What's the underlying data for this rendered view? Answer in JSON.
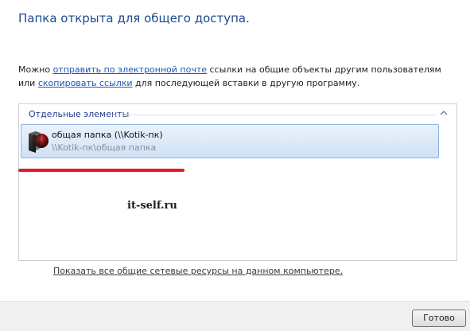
{
  "dialog": {
    "title": "Папка открыта для общего доступа."
  },
  "description": {
    "part1": "Можно ",
    "link_email": "отправить по электронной почте",
    "part2": " ссылки на общие объекты другим пользователям или ",
    "link_copy": "скопировать ссылки",
    "part3": " для последующей вставки в другую программу."
  },
  "items_panel": {
    "group_label": "Отдельные элементы",
    "items": [
      {
        "name": "общая папка (\\\\Kotik-пк)",
        "path": "\\\\Kotik-пк\\общая папка"
      }
    ]
  },
  "watermark": "it-self.ru",
  "show_all_link": "Показать все общие сетевые ресурсы на данном компьютере.",
  "footer": {
    "done_button": "Готово"
  },
  "colors": {
    "title": "#1e4a8c",
    "link": "#1f55b5",
    "selection_border": "#8fb3df",
    "annotation_red": "#e01a2b"
  },
  "icons": {
    "collapse": "chevron-up-icon",
    "folder": "shared-folder-icon"
  }
}
